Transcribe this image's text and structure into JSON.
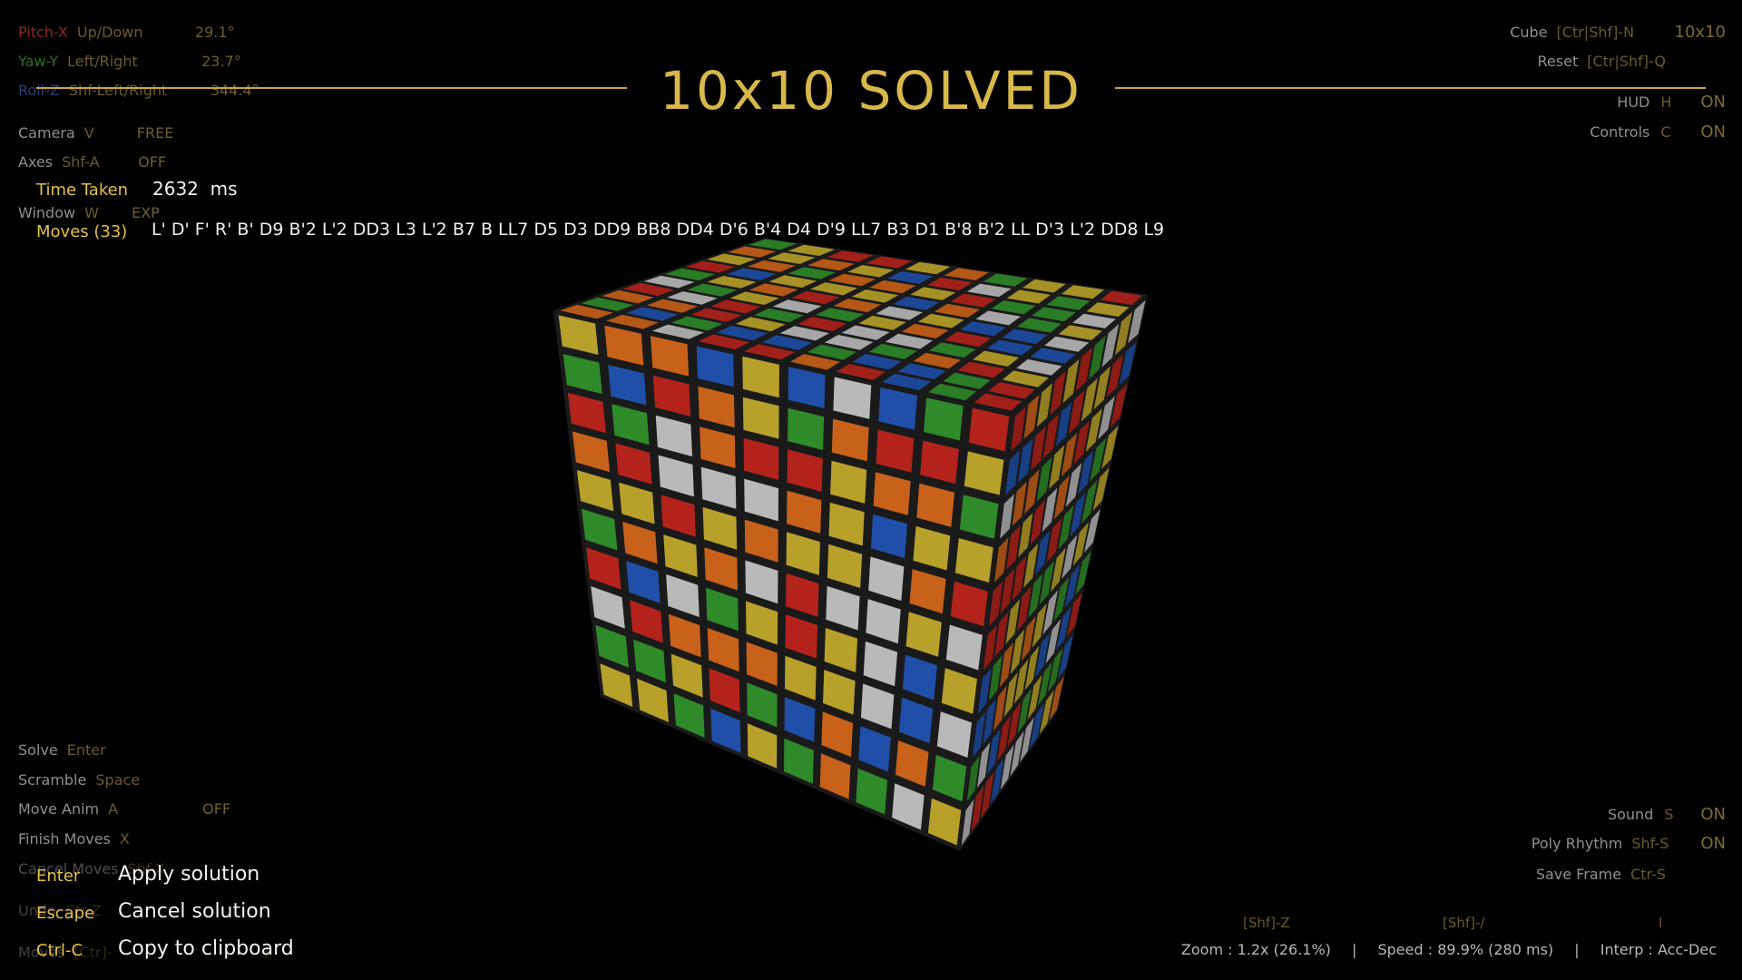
{
  "camera": {
    "pitch": {
      "axis": "Pitch-X",
      "keys": "Up/Down",
      "value": "29.1°"
    },
    "yaw": {
      "axis": "Yaw-Y",
      "keys": "Left/Right",
      "value": "23.7°"
    },
    "roll": {
      "axis": "Roll-Z",
      "keys": "Shf-Left/Right",
      "value": "344.4°"
    },
    "camera_mode": {
      "label": "Camera",
      "key": "V",
      "value": "FREE"
    },
    "axes": {
      "label": "Axes",
      "key": "Shf-A",
      "value": "OFF"
    },
    "window": {
      "label": "Window",
      "key": "W",
      "value": "EXP"
    }
  },
  "title": "10x10 SOLVED",
  "solution": {
    "time_label": "Time Taken",
    "time_value": "2632",
    "time_unit": "ms",
    "moves_label": "Moves (33)",
    "moves_value": "L' D' F' R' B' D9 B'2 L'2 DD3 L3 L'2 B7 B LL7 D5 D3 DD9 BB8 DD4 D'6 B'4 D4 D'9 LL7 B3 D1 B'8 B'2 LL D'3 L'2 DD8 L9"
  },
  "right_panel": {
    "cube": {
      "label": "Cube",
      "key": "[Ctr|Shf]-N",
      "value": "10x10"
    },
    "reset": {
      "label": "Reset",
      "key": "[Ctr|Shf]-Q"
    },
    "hud": {
      "label": "HUD",
      "key": "H",
      "value": "ON"
    },
    "controls": {
      "label": "Controls",
      "key": "C",
      "value": "ON"
    },
    "sound": {
      "label": "Sound",
      "key": "S",
      "value": "ON"
    },
    "poly_rhythm": {
      "label": "Poly Rhythm",
      "key": "Shf-S",
      "value": "ON"
    },
    "save_frame": {
      "label": "Save Frame",
      "key": "Ctr-S"
    }
  },
  "left_controls": {
    "solve": {
      "label": "Solve",
      "key": "Enter"
    },
    "scramble": {
      "label": "Scramble",
      "key": "Space"
    },
    "move_anim": {
      "label": "Move Anim",
      "key": "A",
      "value": "OFF"
    },
    "finish_moves": {
      "label": "Finish Moves",
      "key": "X"
    },
    "cancel_moves": {
      "label": "Cancel Moves",
      "key": "Shf-X"
    },
    "undo": {
      "label": "Undo",
      "key": "Ctr-Z"
    },
    "moves": {
      "label": "Moves",
      "key": "[Ctr]-",
      "value": "3"
    }
  },
  "actions": [
    {
      "key": "Enter",
      "label": "Apply solution"
    },
    {
      "key": "Escape",
      "label": "Cancel solution"
    },
    {
      "key": "Ctrl-C",
      "label": "Copy to clipboard"
    }
  ],
  "status": {
    "zoom_key": "[Shf]-Z",
    "speed_key": "[Shf]-/",
    "interp_key": "I",
    "zoom": "Zoom : 1.2x (26.1%)",
    "speed": "Speed : 89.9% (280 ms)",
    "interp": "Interp : Acc-Dec",
    "sep": "|"
  },
  "colors": {
    "accent": "#d7b84a",
    "red": "#b3231c",
    "orange": "#c8611a",
    "yellow": "#b8a12a",
    "green": "#2f8a2a",
    "blue": "#1f4fa8",
    "white": "#b9b9b9"
  },
  "cube_icon": "rubiks-cube-10x10"
}
